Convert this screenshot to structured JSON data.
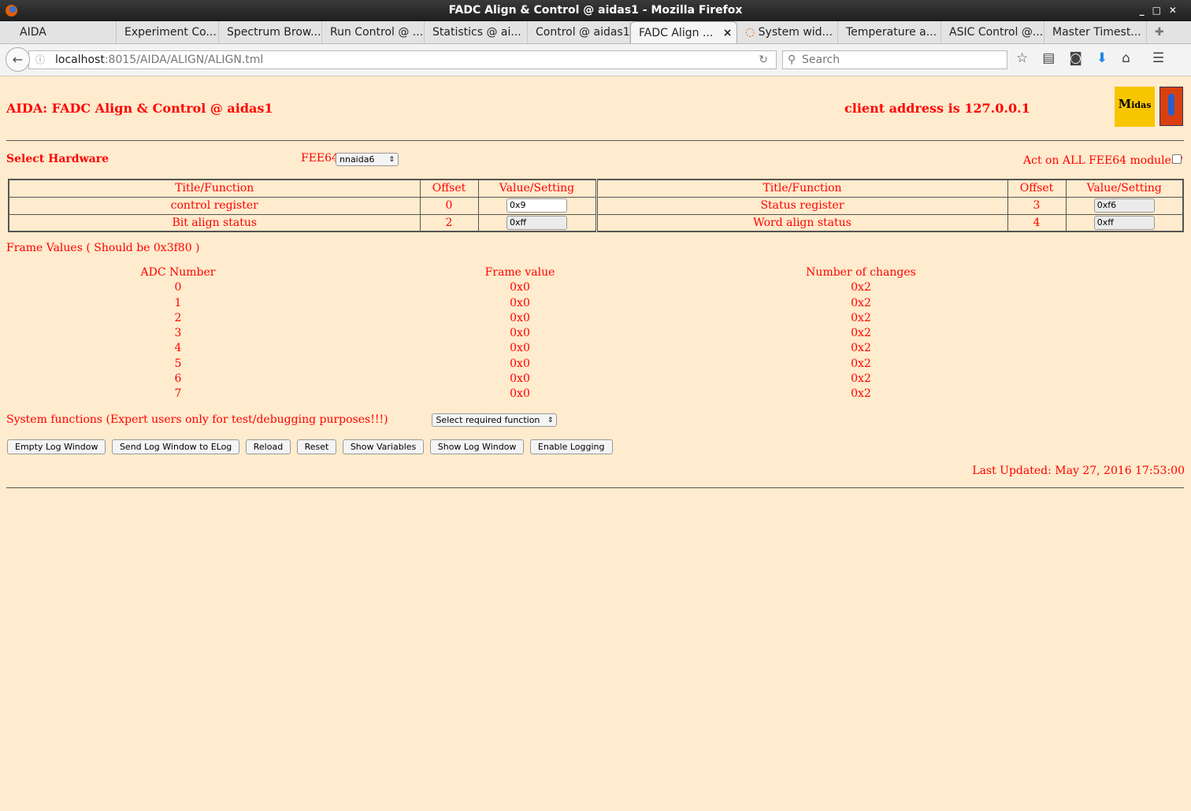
{
  "window": {
    "title": "FADC Align & Control @ aidas1 - Mozilla Firefox"
  },
  "tabs": [
    "AIDA",
    "Experiment Co...",
    "Spectrum Brow...",
    "Run Control @ ...",
    "Statistics @ ai...",
    "Control @ aidas1",
    "FADC Align ...",
    "System wid...",
    "Temperature a...",
    "ASIC Control @...",
    "Master Timest..."
  ],
  "url": {
    "host": "localhost",
    "path": ":8015/AIDA/ALIGN/ALIGN.tml"
  },
  "search_placeholder": "Search",
  "page": {
    "title": "AIDA: FADC Align & Control @ aidas1",
    "client": "client address is 127.0.0.1",
    "logos": [
      "Midas",
      "TCL powered"
    ],
    "select_hardware": "Select Hardware",
    "fee_label": "FEE64",
    "fee_value": "nnaida6",
    "act_all": "Act on ALL FEE64 modules?",
    "reg_headers": [
      "Title/Function",
      "Offset",
      "Value/Setting",
      "Title/Function",
      "Offset",
      "Value/Setting"
    ],
    "registers": [
      {
        "t1": "control register",
        "o1": "0",
        "v1": "0x9",
        "t2": "Status register",
        "o2": "3",
        "v2": "0xf6"
      },
      {
        "t1": "Bit align status",
        "o1": "2",
        "v1": "0xff",
        "t2": "Word align status",
        "o2": "4",
        "v2": "0xff"
      }
    ],
    "frame_title": "Frame Values ( Should be 0x3f80 )",
    "frame_headers": [
      "ADC Number",
      "Frame value",
      "Number of changes"
    ],
    "frames": [
      [
        "0",
        "0x0",
        "0x2"
      ],
      [
        "1",
        "0x0",
        "0x2"
      ],
      [
        "2",
        "0x0",
        "0x2"
      ],
      [
        "3",
        "0x0",
        "0x2"
      ],
      [
        "4",
        "0x0",
        "0x2"
      ],
      [
        "5",
        "0x0",
        "0x2"
      ],
      [
        "6",
        "0x0",
        "0x2"
      ],
      [
        "7",
        "0x0",
        "0x2"
      ]
    ],
    "sys_label": "System functions (Expert users only for test/debugging purposes!!!)",
    "sys_select": "Select required function",
    "buttons": [
      "Empty Log Window",
      "Send Log Window to ELog",
      "Reload",
      "Reset",
      "Show Variables",
      "Show Log Window",
      "Enable Logging"
    ],
    "last_updated": "Last Updated: May 27, 2016 17:53:00"
  }
}
